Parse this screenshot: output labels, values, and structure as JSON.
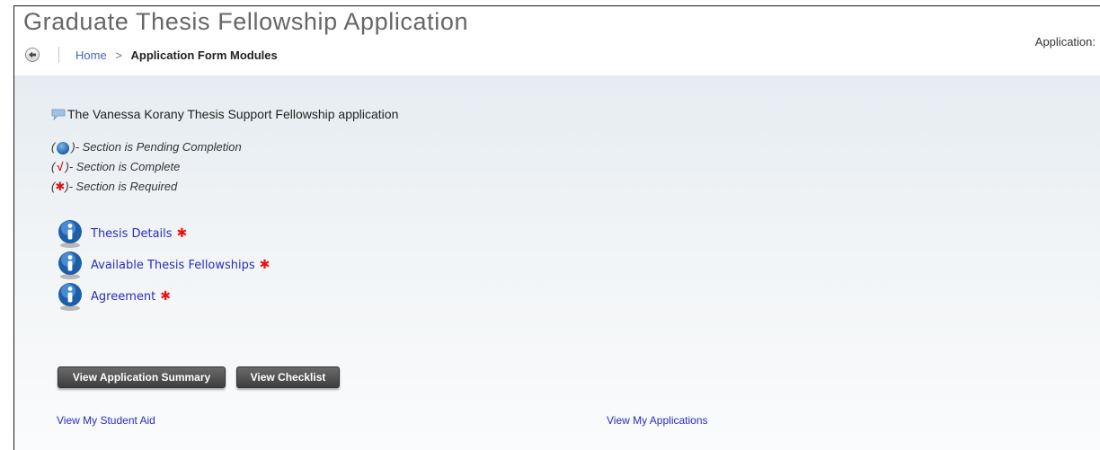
{
  "header": {
    "title": "Graduate Thesis Fellowship Application",
    "application_label": "Application:"
  },
  "breadcrumb": {
    "home": "Home",
    "separator": ">",
    "current": "Application Form Modules"
  },
  "intro": {
    "text": "The Vanessa Korany Thesis Support Fellowship application",
    "icon": "comment-icon"
  },
  "legend": [
    {
      "open": "(",
      "icon": "info-icon",
      "close": ")",
      "text": " - Section is Pending Completion"
    },
    {
      "open": "(",
      "icon": "checkmark-icon",
      "symbol": "√",
      "close": ")",
      "text": " - Section is Complete"
    },
    {
      "open": "(",
      "icon": "asterisk-icon",
      "symbol": "✱",
      "close": ")",
      "text": " - Section is Required"
    }
  ],
  "sections": [
    {
      "label": "Thesis Details",
      "required_mark": "✱",
      "status": "pending"
    },
    {
      "label": "Available Thesis Fellowships",
      "required_mark": "✱",
      "status": "pending"
    },
    {
      "label": "Agreement",
      "required_mark": "✱",
      "status": "pending"
    }
  ],
  "buttons": {
    "summary": "View Application Summary",
    "checklist": "View Checklist"
  },
  "footer": {
    "student_aid": "View My Student Aid",
    "applications": "View My Applications"
  },
  "colors": {
    "link": "#2c2cc0",
    "required": "#dd1111",
    "button_bg": "#4a4a4a",
    "title": "#666666"
  }
}
